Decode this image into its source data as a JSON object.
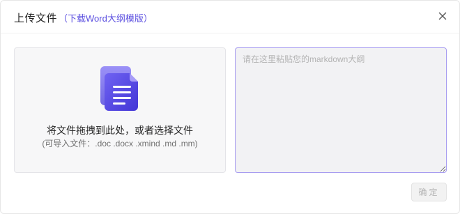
{
  "dialog": {
    "title": "上传文件",
    "template_link": "（下载Word大纲模版）",
    "close_icon": "close-icon"
  },
  "dropzone": {
    "icon": "document-icon",
    "primary_text": "将文件拖拽到此处，或者选择文件",
    "secondary_text": "(可导入文件：.doc .docx .xmind .md .mm)"
  },
  "editor": {
    "placeholder": "请在这里粘贴您的markdown大纲",
    "value": ""
  },
  "footer": {
    "confirm_label": "确定"
  },
  "colors": {
    "accent": "#5b4fe0",
    "icon_gradient_top": "#7a6cf5",
    "icon_gradient_bottom": "#4a3fd8",
    "editor_border": "#a79cf0"
  }
}
